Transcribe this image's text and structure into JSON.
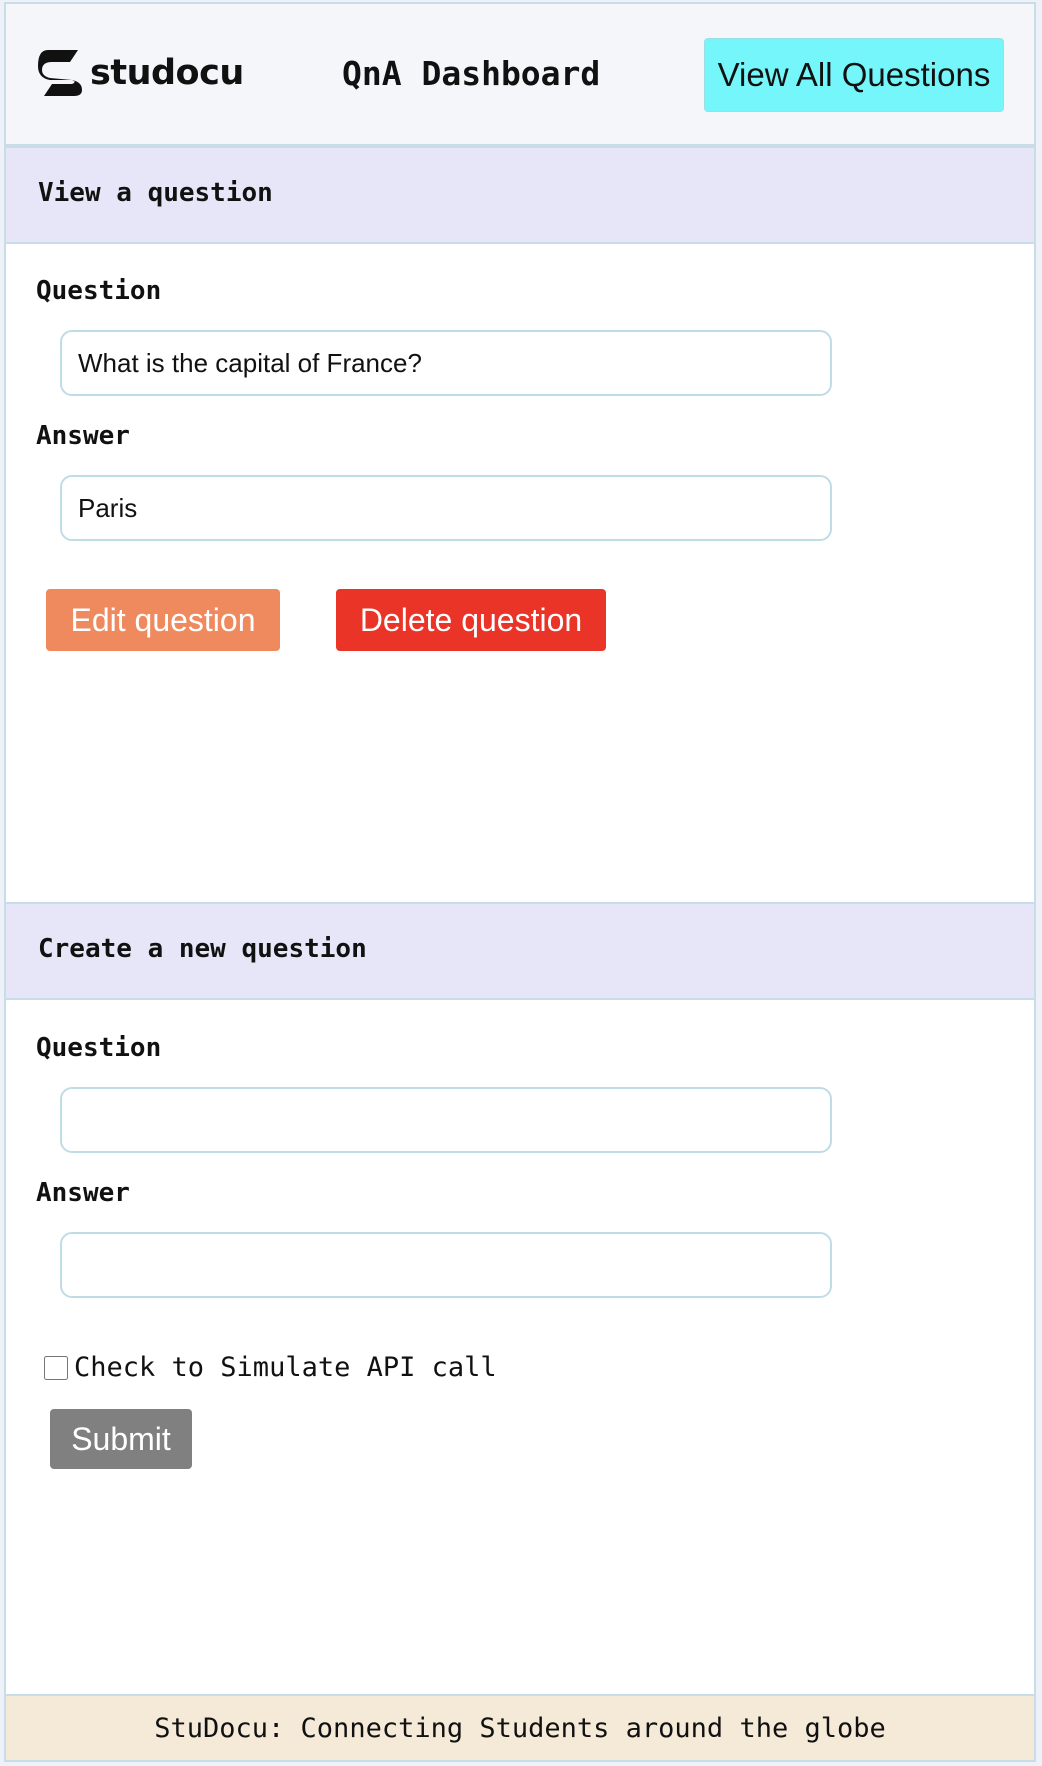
{
  "header": {
    "logo_text": "studocu",
    "title": "QnA Dashboard",
    "view_all_label": "View All Questions"
  },
  "view_section": {
    "title": "View a question",
    "question_label": "Question",
    "question_value": "What is the capital of France?",
    "answer_label": "Answer",
    "answer_value": "Paris",
    "edit_label": "Edit question",
    "delete_label": "Delete question"
  },
  "create_section": {
    "title": "Create a new question",
    "question_label": "Question",
    "question_value": "",
    "answer_label": "Answer",
    "answer_value": "",
    "checkbox_label": "Check to Simulate API call",
    "checkbox_checked": false,
    "submit_label": "Submit"
  },
  "footer": {
    "text": "StuDocu: Connecting Students around the globe"
  },
  "colors": {
    "view_all_button": "#74f6fb",
    "edit_button": "#ef8a5f",
    "delete_button": "#e93427",
    "submit_button": "#808080",
    "section_bar": "#e6e6f8",
    "footer_bg": "#f5ead8"
  },
  "icons": {
    "logo": "studocu-logo-icon"
  }
}
